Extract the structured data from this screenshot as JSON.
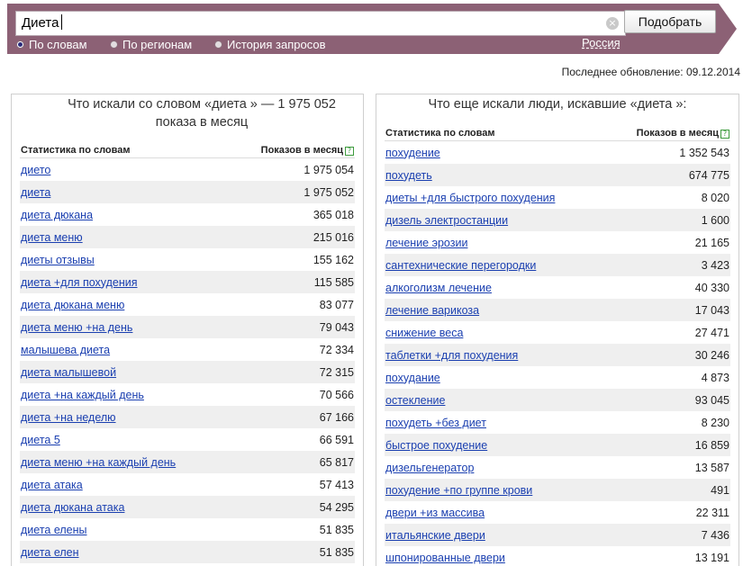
{
  "search": {
    "query": "Диета",
    "button_label": "Подобрать"
  },
  "tabs": [
    {
      "label": "По словам",
      "checked": true
    },
    {
      "label": "По регионам",
      "checked": false
    },
    {
      "label": "История запросов",
      "checked": false
    }
  ],
  "region": "Россия",
  "last_update": "Последнее обновление: 09.12.2014",
  "left": {
    "title_line1": "Что искали со словом «диета » — 1 975 052",
    "title_line2": "показа в месяц",
    "col_phrase": "Статистика по словам",
    "col_count": "Показов в месяц",
    "rows": [
      {
        "phrase": "дието",
        "count": "1 975 054"
      },
      {
        "phrase": "диета",
        "count": "1 975 052"
      },
      {
        "phrase": "диета дюкана",
        "count": "365 018"
      },
      {
        "phrase": "диета меню",
        "count": "215 016"
      },
      {
        "phrase": "диеты отзывы",
        "count": "155 162"
      },
      {
        "phrase": "диета +для похудения",
        "count": "115 585"
      },
      {
        "phrase": "диета дюкана меню",
        "count": "83 077"
      },
      {
        "phrase": "диета меню +на день",
        "count": "79 043"
      },
      {
        "phrase": "малышева диета",
        "count": "72 334"
      },
      {
        "phrase": "диета малышевой",
        "count": "72 315"
      },
      {
        "phrase": "диета +на каждый день",
        "count": "70 566"
      },
      {
        "phrase": "диета +на неделю",
        "count": "67 166"
      },
      {
        "phrase": "диета 5",
        "count": "66 591"
      },
      {
        "phrase": "диета меню +на каждый день",
        "count": "65 817"
      },
      {
        "phrase": "диета атака",
        "count": "57 413"
      },
      {
        "phrase": "диета дюкана атака",
        "count": "54 295"
      },
      {
        "phrase": "диета елены",
        "count": "51 835"
      },
      {
        "phrase": "диета елен",
        "count": "51 835"
      }
    ]
  },
  "right": {
    "title": "Что еще искали люди, искавшие «диета »:",
    "col_phrase": "Статистика по словам",
    "col_count": "Показов в месяц",
    "rows": [
      {
        "phrase": "похудение",
        "count": "1 352 543"
      },
      {
        "phrase": "похудеть",
        "count": "674 775"
      },
      {
        "phrase": "диеты +для быстрого похудения",
        "count": "8 020"
      },
      {
        "phrase": "дизель электростанции",
        "count": "1 600"
      },
      {
        "phrase": "лечение эрозии",
        "count": "21 165"
      },
      {
        "phrase": "сантехнические перегородки",
        "count": "3 423"
      },
      {
        "phrase": "алкоголизм лечение",
        "count": "40 330"
      },
      {
        "phrase": "лечение варикоза",
        "count": "17 043"
      },
      {
        "phrase": "снижение веса",
        "count": "27 471"
      },
      {
        "phrase": "таблетки +для похудения",
        "count": "30 246"
      },
      {
        "phrase": "похудание",
        "count": "4 873"
      },
      {
        "phrase": "остекление",
        "count": "93 045"
      },
      {
        "phrase": "похудеть +без диет",
        "count": "8 230"
      },
      {
        "phrase": "быстрое похудение",
        "count": "16 859"
      },
      {
        "phrase": "дизельгенератор",
        "count": "13 587"
      },
      {
        "phrase": "похудение +по группе крови",
        "count": "491"
      },
      {
        "phrase": "двери +из массива",
        "count": "22 311"
      },
      {
        "phrase": "итальянские двери",
        "count": "7 436"
      },
      {
        "phrase": "шпонированные двери",
        "count": "13 191"
      }
    ]
  },
  "colors": {
    "bar": "#8c6175",
    "link": "#1a3fb0",
    "row_alt": "#efefef"
  }
}
